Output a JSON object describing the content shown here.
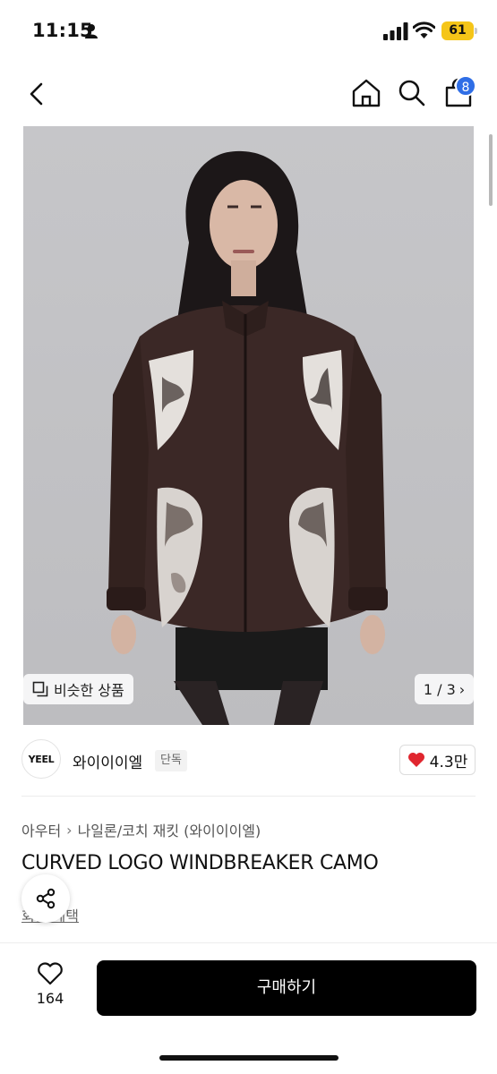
{
  "status_bar": {
    "time": "11:15",
    "battery": "61"
  },
  "nav": {
    "cart_count": "8"
  },
  "gallery": {
    "similar_label": "비슷한 상품",
    "page_indicator": "1 / 3"
  },
  "brand": {
    "logo_text": "YEEL",
    "name": "와이이이엘",
    "tag": "단독",
    "likes": "4.3만"
  },
  "product": {
    "breadcrumb": [
      "아우터",
      "나일론/코치 재킷 (와이이이엘)"
    ],
    "title": "CURVED LOGO WINDBREAKER CAMO",
    "sub_link": "회원 혜택"
  },
  "bottom_bar": {
    "wish_count": "164",
    "buy_label": "구매하기"
  },
  "colors": {
    "accent_blue": "#2f6ee6",
    "heart_red": "#e0262f",
    "battery_yellow": "#f5c518",
    "buy_button": "#000000"
  }
}
